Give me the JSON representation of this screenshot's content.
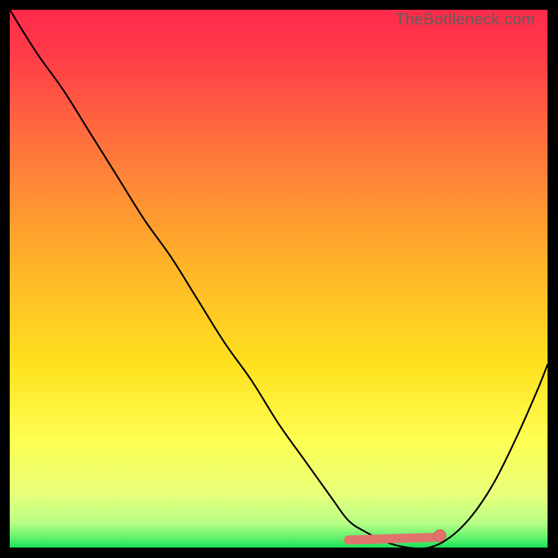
{
  "watermark": "TheBottleneck.com",
  "colors": {
    "gradient_top": "#ff2b4a",
    "gradient_mid": "#ffd21f",
    "gradient_low": "#f7ff8a",
    "gradient_bottom": "#19e35a",
    "curve": "#000000",
    "marker_fill": "#e0746d",
    "marker_stroke": "#d3584f",
    "frame_bg": "#000000"
  },
  "chart_data": {
    "type": "line",
    "title": "",
    "xlabel": "",
    "ylabel": "",
    "xlim": [
      0,
      100
    ],
    "ylim": [
      0,
      100
    ],
    "grid": false,
    "legend": false,
    "series": [
      {
        "name": "bottleneck-curve",
        "x": [
          0,
          5,
          10,
          15,
          20,
          25,
          30,
          35,
          40,
          45,
          50,
          55,
          60,
          63,
          66,
          70,
          74,
          78,
          82,
          86,
          90,
          94,
          98,
          100
        ],
        "y": [
          100,
          92,
          85,
          77,
          69,
          61,
          54,
          46,
          38,
          31,
          23,
          16,
          9,
          5,
          3,
          1,
          0,
          0,
          2,
          6,
          12,
          20,
          29,
          34
        ]
      }
    ],
    "optimal_band": {
      "x_start": 63,
      "x_end": 80,
      "y": 1.8
    },
    "optimal_point": {
      "x": 80,
      "y": 2.2
    }
  }
}
